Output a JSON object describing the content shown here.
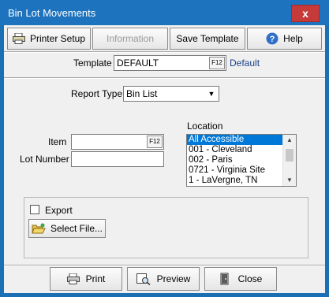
{
  "window": {
    "title": "Bin Lot Movements",
    "close_glyph": "x"
  },
  "toolbar": {
    "printer_setup": "Printer Setup",
    "information": "Information",
    "save_template": "Save Template",
    "help": "Help"
  },
  "template": {
    "label": "Template",
    "value": "DEFAULT",
    "f12": "F12",
    "default_link": "Default"
  },
  "report_type": {
    "label": "Report Type",
    "selected": "Bin List"
  },
  "item": {
    "label": "Item",
    "value": "",
    "f12": "F12"
  },
  "lot_number": {
    "label": "Lot Number",
    "value": ""
  },
  "location": {
    "label": "Location",
    "items": [
      "All Accessible",
      "001 - Cleveland",
      "002 - Paris",
      "0721 - Virginia Site",
      "1 - LaVergne, TN"
    ],
    "selected_index": 0
  },
  "export": {
    "label": "Export",
    "checked": false,
    "select_file": "Select File..."
  },
  "footer": {
    "print": "Print",
    "preview": "Preview",
    "close": "Close"
  }
}
